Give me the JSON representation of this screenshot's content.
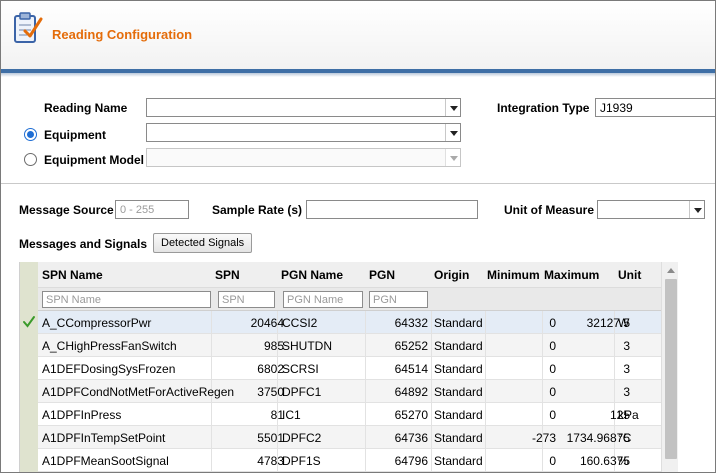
{
  "app": {
    "title": "Reading Configuration",
    "icon": "clipboard-check-icon"
  },
  "form": {
    "reading_name_label": "Reading Name",
    "reading_name_value": "",
    "equipment_label": "Equipment",
    "equipment_value": "",
    "equipment_checked": true,
    "equipment_model_label": "Equipment Model",
    "equipment_model_value": "",
    "integration_type_label": "Integration Type",
    "integration_type_value": "J1939"
  },
  "settings": {
    "message_source_label": "Message Source",
    "message_source_placeholder": "0 - 255",
    "sample_rate_label": "Sample Rate (s)",
    "unit_of_measure_label": "Unit of Measure",
    "messages_signals_label": "Messages and Signals",
    "detected_signals_button": "Detected Signals"
  },
  "grid": {
    "headers": [
      "SPN Name",
      "SPN",
      "PGN Name",
      "PGN",
      "Origin",
      "Minimum",
      "Maximum",
      "Unit"
    ],
    "filters": {
      "spn_name": "SPN Name",
      "spn": "SPN",
      "pgn_name": "PGN Name",
      "pgn": "PGN"
    },
    "rows": [
      {
        "spn_name": "A_CCompressorPwr",
        "spn": "20464",
        "pgn_name": "CCSI2",
        "pgn": "64332",
        "origin": "Standard",
        "minimum": "0",
        "maximum": "32127.5",
        "unit": "W",
        "selected": true
      },
      {
        "spn_name": "A_CHighPressFanSwitch",
        "spn": "985",
        "pgn_name": "SHUTDN",
        "pgn": "65252",
        "origin": "Standard",
        "minimum": "0",
        "maximum": "3",
        "unit": "",
        "selected": false
      },
      {
        "spn_name": "A1DEFDosingSysFrozen",
        "spn": "6802",
        "pgn_name": "SCRSI",
        "pgn": "64514",
        "origin": "Standard",
        "minimum": "0",
        "maximum": "3",
        "unit": "",
        "selected": false
      },
      {
        "spn_name": "A1DPFCondNotMetForActiveRegen",
        "spn": "3750",
        "pgn_name": "DPFC1",
        "pgn": "64892",
        "origin": "Standard",
        "minimum": "0",
        "maximum": "3",
        "unit": "",
        "selected": false
      },
      {
        "spn_name": "A1DPFInPress",
        "spn": "81",
        "pgn_name": "IC1",
        "pgn": "65270",
        "origin": "Standard",
        "minimum": "0",
        "maximum": "125",
        "unit": "kPa",
        "selected": false
      },
      {
        "spn_name": "A1DPFInTempSetPoint",
        "spn": "5501",
        "pgn_name": "DPFC2",
        "pgn": "64736",
        "origin": "Standard",
        "minimum": "-273",
        "maximum": "1734.96875",
        "unit": "°C",
        "selected": false
      },
      {
        "spn_name": "A1DPFMeanSootSignal",
        "spn": "4783",
        "pgn_name": "DPF1S",
        "pgn": "64796",
        "origin": "Standard",
        "minimum": "0",
        "maximum": "160.6375",
        "unit": "%",
        "selected": false
      }
    ]
  },
  "colors": {
    "title": "#e46c0a",
    "header_bar": "#3f6fa6",
    "selected_row": "#e4ecf6",
    "check": "#3a9a2a",
    "radio": "#1f6ed4"
  }
}
